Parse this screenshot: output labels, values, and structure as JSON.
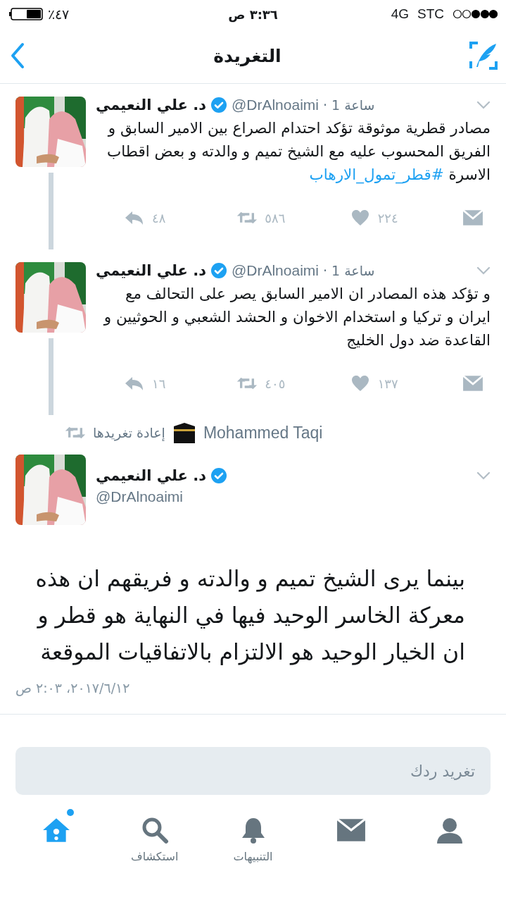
{
  "status_bar": {
    "battery_text": "٪٤٧",
    "time": "٣:٣٦ ص",
    "network": "4G",
    "carrier": "STC"
  },
  "nav": {
    "title": "التغريدة"
  },
  "thread": [
    {
      "name": "د. علي النعيمي",
      "verified": true,
      "handle": "@DrAlnoaimi",
      "separator": "·",
      "time": "1 ساعة",
      "text": "مصادر قطرية موثوقة تؤكد احتدام الصراع بين الامير السابق و الفريق المحسوب عليه مع الشيخ تميم و والدته و بعض اقطاب الاسرة",
      "hashtag": "#قطر_تمول_الارهاب",
      "replies": "٤٨",
      "retweets": "٥٨٦",
      "likes": "٢٢٤"
    },
    {
      "name": "د. علي النعيمي",
      "verified": true,
      "handle": "@DrAlnoaimi",
      "separator": "·",
      "time": "1 ساعة",
      "text": "و تؤكد هذه المصادر ان الامير السابق يصر على التحالف مع ايران و تركيا و استخدام الاخوان و الحشد الشعبي و الحوثيين و القاعدة ضد دول الخليج",
      "replies": "١٦",
      "retweets": "٤٠٥",
      "likes": "١٣٧"
    }
  ],
  "retweeted_by": {
    "label": "إعادة تغريدها",
    "name": "Mohammed Taqi"
  },
  "main_tweet": {
    "name": "د. علي النعيمي",
    "verified": true,
    "handle": "@DrAlnoaimi",
    "text": "بينما يرى الشيخ تميم و والدته و فريقهم ان هذه معركة الخاسر الوحيد فيها في النهاية هو قطر و ان الخيار الوحيد هو الالتزام بالاتفاقيات الموقعة",
    "timestamp": "٢٠١٧/٦/١٢، ٢:٠٣ ص"
  },
  "reply_field": {
    "placeholder": "تغريد ردك"
  },
  "tab_bar": [
    {
      "kind": "person",
      "selected": false,
      "dot": false
    },
    {
      "kind": "mail",
      "selected": false,
      "dot": false
    },
    {
      "kind": "bell",
      "label": "التنبيهات",
      "selected": false,
      "dot": false
    },
    {
      "kind": "search",
      "label": "استكشاف",
      "selected": false,
      "dot": false
    },
    {
      "kind": "home",
      "selected": true,
      "dot": true
    }
  ]
}
